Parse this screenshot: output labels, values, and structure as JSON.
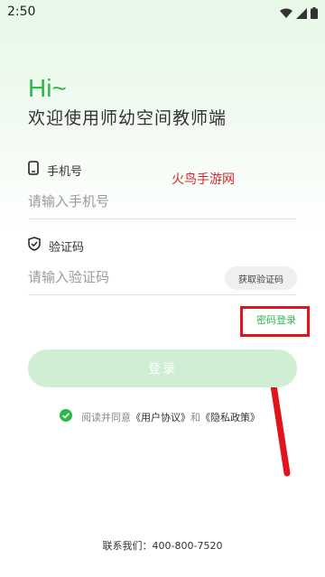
{
  "status": {
    "time": "2:50"
  },
  "greeting": {
    "hi": "Hi~",
    "welcome": "欢迎使用师幼空间教师端"
  },
  "phone": {
    "label": "手机号",
    "placeholder": "请输入手机号"
  },
  "code": {
    "label": "验证码",
    "placeholder": "请输入验证码",
    "get_code_button": "获取验证码"
  },
  "watermark": "火鸟手游网",
  "password_login_link": "密码登录",
  "login_button": "登录",
  "agreement": {
    "prefix": "阅读并同意",
    "user_agreement": "《用户协议》",
    "and": "和",
    "privacy_policy": "《隐私政策》",
    "checked": true
  },
  "contact": "联系我们：400-800-7520",
  "colors": {
    "accent": "#2fb84a",
    "annotation": "#e0141c",
    "login_disabled": "#cfeed3"
  }
}
